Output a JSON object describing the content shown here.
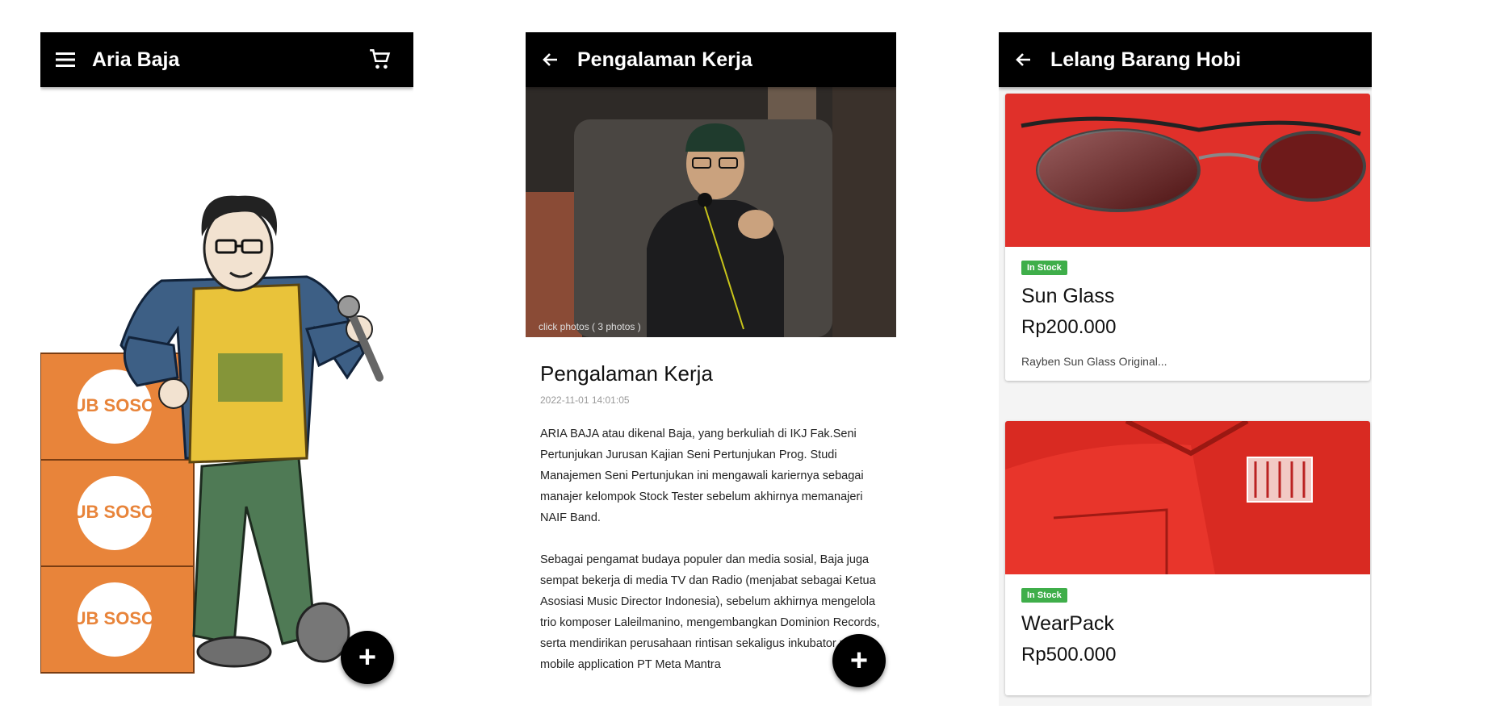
{
  "screens": {
    "profile": {
      "title": "Aria Baja",
      "menu_icon": "menu-icon",
      "cart_icon": "cart-icon",
      "box_labels": [
        "SUB SOSOR",
        "SUB SOSOR",
        "SUB SOSOR"
      ],
      "fab_label": "+"
    },
    "article": {
      "title": "Pengalaman Kerja",
      "back_icon": "arrow-back-icon",
      "photo_caption": "click photos ( 3 photos )",
      "heading": "Pengalaman Kerja",
      "date": "2022-11-01 14:01:05",
      "paragraphs": [
        "ARIA BAJA atau dikenal Baja, yang berkuliah di IKJ Fak.Seni Pertunjukan Jurusan Kajian Seni Pertunjukan Prog. Studi Manajemen Seni Pertunjukan ini mengawali kariernya sebagai manajer kelompok Stock Tester sebelum akhirnya memanajeri NAIF Band.",
        "Sebagai pengamat budaya populer dan media sosial, Baja juga sempat bekerja di media TV dan Radio (menjabat sebagai Ketua Asosiasi Music Director Indonesia), sebelum akhirnya mengelola trio komposer Laleilmanino, mengembangkan Dominion Records, serta mendirikan perusahaan rintisan sekaligus inkubator untuk mobile application PT Meta Mantra"
      ],
      "fab_label": "+"
    },
    "auction": {
      "title": "Lelang Barang Hobi",
      "back_icon": "arrow-back-icon",
      "items": [
        {
          "badge": "In Stock",
          "name": "Sun Glass",
          "price": "Rp200.000",
          "desc": "Rayben Sun Glass Original..."
        },
        {
          "badge": "In Stock",
          "name": "WearPack",
          "price": "Rp500.000",
          "desc": ""
        }
      ]
    }
  },
  "colors": {
    "appbar": "#000000",
    "badge_green": "#3fae4a",
    "box_orange": "#e8843a",
    "shirt_yellow": "#e9c33a",
    "product_red": "#e0302a"
  }
}
